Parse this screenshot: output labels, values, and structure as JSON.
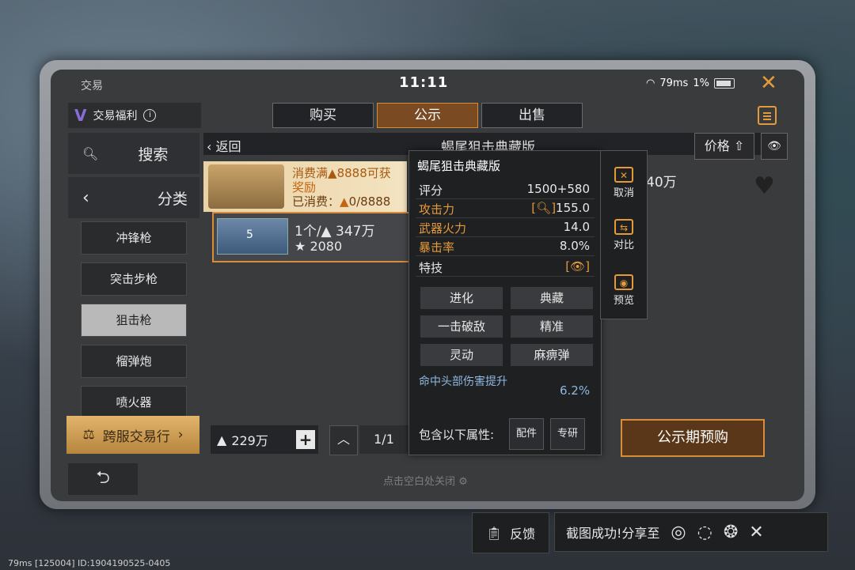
{
  "top": {
    "title": "交易",
    "time": "11:11",
    "ping": "79ms",
    "battery": "1%"
  },
  "welfare": {
    "label": "交易福利",
    "logo": "V"
  },
  "tabs": [
    {
      "label": "购买"
    },
    {
      "label": "公示"
    },
    {
      "label": "出售"
    }
  ],
  "sidebar": {
    "search": "搜索",
    "category": "分类",
    "items": [
      {
        "label": "冲锋枪"
      },
      {
        "label": "突击步枪"
      },
      {
        "label": "狙击枪"
      },
      {
        "label": "榴弹炮"
      },
      {
        "label": "喷火器"
      }
    ],
    "cross_server": "跨服交易行"
  },
  "header": {
    "back": "返回",
    "title": "蝎尾狙击典藏版",
    "price": "价格"
  },
  "promo": {
    "line1": "消费满",
    "threshold": "8888可获",
    "line2": "奖励",
    "line3": "已消费：",
    "spent": "0/8888"
  },
  "listing": {
    "qty_price": "1个/",
    "price_val": "347万",
    "score": "2080",
    "stars": "5",
    "right_price": "40万"
  },
  "bottom": {
    "money": "229万",
    "page": "1/1",
    "preorder": "公示期预购",
    "tap_close": "点击空白处关闭"
  },
  "popup": {
    "title": "蝎尾狙击典藏版",
    "rows": [
      {
        "k": "评分",
        "v": "1500+580"
      },
      {
        "k": "攻击力",
        "v": "155.0"
      },
      {
        "k": "武器火力",
        "v": "14.0"
      },
      {
        "k": "暴击率",
        "v": "8.0%"
      },
      {
        "k": "特技",
        "v": ""
      }
    ],
    "tags": [
      "进化",
      "典藏",
      "一击破敌",
      "精准",
      "灵动",
      "麻痹弹"
    ],
    "extra_k": "命中头部伤害提升",
    "extra_v": "6.2%",
    "footer": "包含以下属性:",
    "chip1": "配件",
    "chip2": "专研"
  },
  "side_panel": {
    "cancel": "取消",
    "compare": "对比",
    "preview": "预览"
  },
  "feedback": "反馈",
  "share": "截图成功!分享至",
  "bottom_status": "79ms   [125004] ID:1904190525-0405",
  "colors": {
    "accent": "#e59a3a",
    "frame": "#9da0a4",
    "panel": "#1f2022"
  }
}
